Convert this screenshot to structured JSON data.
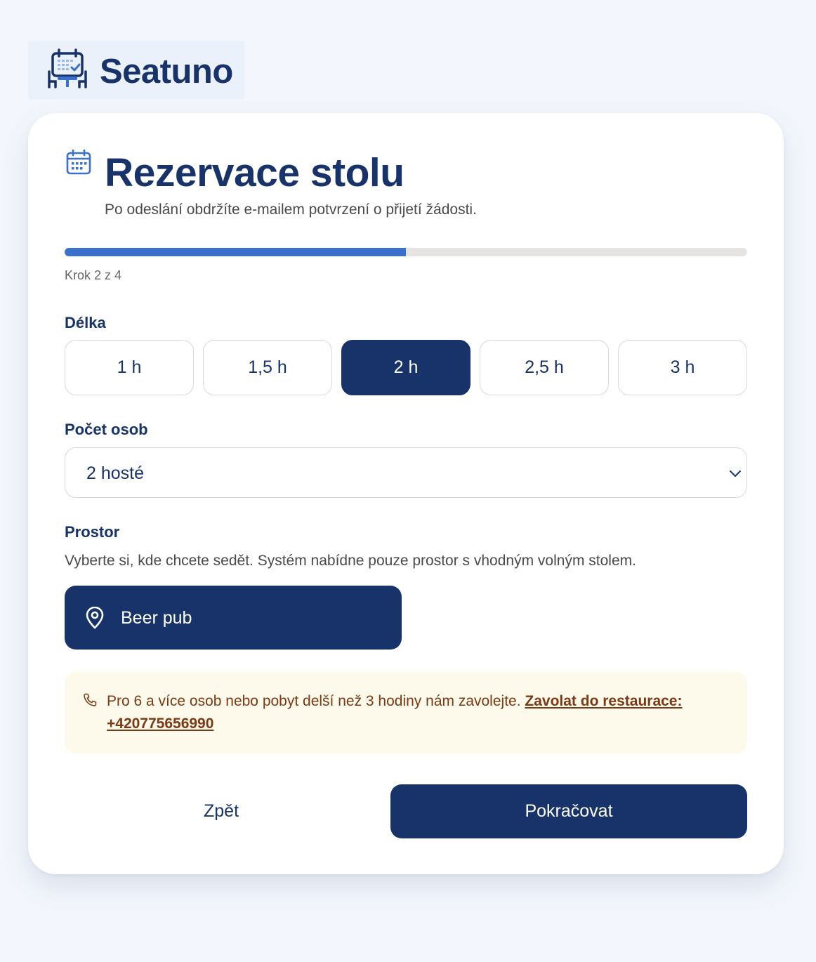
{
  "brand": {
    "name": "Seatuno",
    "logo_icon": "calendar-table-icon"
  },
  "header": {
    "icon": "calendar-icon",
    "title": "Rezervace stolu",
    "subtitle": "Po odeslání obdržíte e-mailem potvrzení o přijetí žádosti."
  },
  "progress": {
    "label": "Krok 2 z 4",
    "current_step": 2,
    "total_steps": 4,
    "fraction": 0.5
  },
  "duration": {
    "label": "Délka",
    "options": [
      "1 h",
      "1,5 h",
      "2 h",
      "2,5 h",
      "3 h"
    ],
    "selected": "2 h"
  },
  "guests": {
    "label": "Počet osob",
    "value": "2 hosté"
  },
  "area": {
    "label": "Prostor",
    "help": "Vyberte si, kde chcete sedět. Systém nabídne pouze prostor s vhodným volným stolem.",
    "option": "Beer pub",
    "option_icon": "location-pin-icon"
  },
  "notice": {
    "icon": "phone-icon",
    "text": "Pro 6 a více osob nebo pobyt delší než 3 hodiny nám zavolejte.",
    "link_text": "Zavolat do restaurace: +420775656990"
  },
  "actions": {
    "back_label": "Zpět",
    "next_label": "Pokračovat"
  },
  "colors": {
    "primary": "#17336a",
    "accent": "#3a71cf",
    "background": "#f3f7fd",
    "notice_bg": "#fdf9eb",
    "notice_text": "#7c3a14"
  }
}
